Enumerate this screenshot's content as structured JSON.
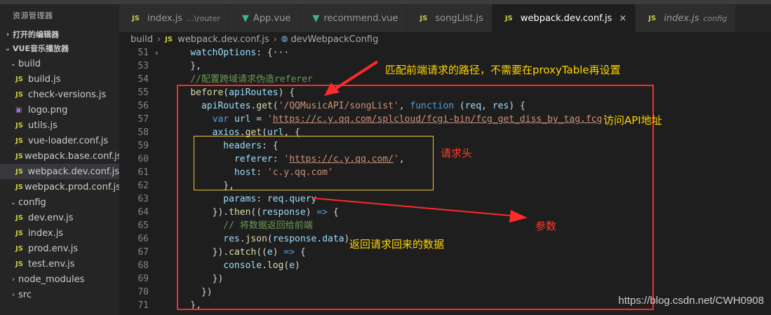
{
  "sidebar": {
    "title": "资源管理器",
    "open_editors": "打开的编辑器",
    "project": "VUE音乐播放器",
    "items": [
      {
        "label": "build",
        "kind": "folder"
      },
      {
        "label": "build.js",
        "kind": "js"
      },
      {
        "label": "check-versions.js",
        "kind": "js"
      },
      {
        "label": "logo.png",
        "kind": "png"
      },
      {
        "label": "utils.js",
        "kind": "js"
      },
      {
        "label": "vue-loader.conf.js",
        "kind": "js"
      },
      {
        "label": "webpack.base.conf.js",
        "kind": "js"
      },
      {
        "label": "webpack.dev.conf.js",
        "kind": "js",
        "selected": true
      },
      {
        "label": "webpack.prod.conf.js",
        "kind": "js"
      },
      {
        "label": "config",
        "kind": "folder"
      },
      {
        "label": "dev.env.js",
        "kind": "js"
      },
      {
        "label": "index.js",
        "kind": "js"
      },
      {
        "label": "prod.env.js",
        "kind": "js"
      },
      {
        "label": "test.env.js",
        "kind": "js"
      },
      {
        "label": "node_modules",
        "kind": "folder-closed"
      },
      {
        "label": "src",
        "kind": "folder-closed"
      }
    ]
  },
  "tabs": [
    {
      "label": "index.js",
      "sub": "...\\router",
      "icon": "js-icon"
    },
    {
      "label": "App.vue",
      "icon": "vue-icon"
    },
    {
      "label": "recommend.vue",
      "icon": "vue-icon"
    },
    {
      "label": "songList.js",
      "icon": "js-icon"
    },
    {
      "label": "webpack.dev.conf.js",
      "icon": "js-icon",
      "active": true,
      "close": "×"
    },
    {
      "label": "index.js",
      "sub": "config",
      "icon": "js-icon",
      "italic": true
    }
  ],
  "breadcrumb": {
    "folder": "build",
    "file": "webpack.dev.conf.js",
    "symbol": "devWebpackConfig"
  },
  "lines": [
    {
      "n": "51",
      "fold": "›",
      "code": [
        {
          "t": "    "
        },
        {
          "c": "prop",
          "t": "watchOptions"
        },
        {
          "t": ": {"
        },
        {
          "c": "pu",
          "t": "···"
        }
      ]
    },
    {
      "n": "53",
      "code": [
        {
          "t": "    },"
        }
      ]
    },
    {
      "n": "54",
      "code": [
        {
          "t": "    "
        },
        {
          "c": "cm",
          "t": "//配置跨域请求伪造referer"
        }
      ]
    },
    {
      "n": "55",
      "code": [
        {
          "t": "    "
        },
        {
          "c": "fn",
          "t": "before"
        },
        {
          "t": "("
        },
        {
          "c": "prop",
          "t": "apiRoutes"
        },
        {
          "t": ") {"
        }
      ]
    },
    {
      "n": "56",
      "code": [
        {
          "t": "      "
        },
        {
          "c": "prop",
          "t": "apiRoutes"
        },
        {
          "t": "."
        },
        {
          "c": "fn",
          "t": "get"
        },
        {
          "t": "("
        },
        {
          "c": "str",
          "t": "'/QQMusicAPI/songList'"
        },
        {
          "t": ", "
        },
        {
          "c": "kw",
          "t": "function"
        },
        {
          "t": " ("
        },
        {
          "c": "prop",
          "t": "req"
        },
        {
          "t": ", "
        },
        {
          "c": "prop",
          "t": "res"
        },
        {
          "t": ") {"
        }
      ]
    },
    {
      "n": "57",
      "code": [
        {
          "t": "        "
        },
        {
          "c": "kw",
          "t": "var"
        },
        {
          "t": " "
        },
        {
          "c": "prop",
          "t": "url"
        },
        {
          "t": " = "
        },
        {
          "c": "str",
          "t": "'"
        },
        {
          "c": "url",
          "t": "https://c.y.qq.com/splcloud/fcgi-bin/fcg_get_diss_by_tag.fcg"
        },
        {
          "c": "str",
          "t": "'"
        }
      ]
    },
    {
      "n": "58",
      "code": [
        {
          "t": "        "
        },
        {
          "c": "prop",
          "t": "axios"
        },
        {
          "t": "."
        },
        {
          "c": "fn",
          "t": "get"
        },
        {
          "t": "("
        },
        {
          "c": "prop",
          "t": "url"
        },
        {
          "t": ", {"
        }
      ]
    },
    {
      "n": "59",
      "code": [
        {
          "t": "          "
        },
        {
          "c": "prop",
          "t": "headers"
        },
        {
          "t": ": {"
        }
      ]
    },
    {
      "n": "60",
      "code": [
        {
          "t": "            "
        },
        {
          "c": "prop",
          "t": "referer"
        },
        {
          "t": ": "
        },
        {
          "c": "str",
          "t": "'"
        },
        {
          "c": "url",
          "t": "https://c.y.qq.com/"
        },
        {
          "c": "str",
          "t": "'"
        },
        {
          "t": ","
        }
      ]
    },
    {
      "n": "61",
      "code": [
        {
          "t": "            "
        },
        {
          "c": "prop",
          "t": "host"
        },
        {
          "t": ": "
        },
        {
          "c": "str",
          "t": "'c.y.qq.com'"
        }
      ]
    },
    {
      "n": "62",
      "code": [
        {
          "t": "          },"
        }
      ]
    },
    {
      "n": "63",
      "code": [
        {
          "t": "          "
        },
        {
          "c": "prop",
          "t": "params"
        },
        {
          "t": ": "
        },
        {
          "c": "prop",
          "t": "req"
        },
        {
          "t": "."
        },
        {
          "c": "prop",
          "t": "query"
        }
      ]
    },
    {
      "n": "64",
      "code": [
        {
          "t": "        })."
        },
        {
          "c": "fn",
          "t": "then"
        },
        {
          "t": "(("
        },
        {
          "c": "prop",
          "t": "response"
        },
        {
          "t": ") "
        },
        {
          "c": "kw",
          "t": "=>"
        },
        {
          "t": " {"
        }
      ]
    },
    {
      "n": "65",
      "code": [
        {
          "t": "          "
        },
        {
          "c": "cm",
          "t": "// 将数据返回给前端"
        }
      ]
    },
    {
      "n": "66",
      "code": [
        {
          "t": "          "
        },
        {
          "c": "prop",
          "t": "res"
        },
        {
          "t": "."
        },
        {
          "c": "fn",
          "t": "json"
        },
        {
          "t": "("
        },
        {
          "c": "prop",
          "t": "response"
        },
        {
          "t": "."
        },
        {
          "c": "prop",
          "t": "data"
        },
        {
          "t": ")"
        }
      ]
    },
    {
      "n": "67",
      "code": [
        {
          "t": "        })."
        },
        {
          "c": "fn",
          "t": "catch"
        },
        {
          "t": "(("
        },
        {
          "c": "prop",
          "t": "e"
        },
        {
          "t": ") "
        },
        {
          "c": "kw",
          "t": "=>"
        },
        {
          "t": " {"
        }
      ]
    },
    {
      "n": "68",
      "code": [
        {
          "t": "          "
        },
        {
          "c": "prop",
          "t": "console"
        },
        {
          "t": "."
        },
        {
          "c": "fn",
          "t": "log"
        },
        {
          "t": "("
        },
        {
          "c": "prop",
          "t": "e"
        },
        {
          "t": ")"
        }
      ]
    },
    {
      "n": "69",
      "code": [
        {
          "t": "        })"
        }
      ]
    },
    {
      "n": "70",
      "code": [
        {
          "t": "      })"
        }
      ]
    },
    {
      "n": "71",
      "code": [
        {
          "t": "    },"
        }
      ]
    }
  ],
  "annotations": {
    "route_note": "匹配前端请求的路径，不需要在proxyTable再设置",
    "api_note": "访问API地址",
    "headers_note": "请求头",
    "params_note": "参数",
    "response_note": "返回请求回来的数据"
  },
  "watermark": "https://blog.csdn.net/CWH0908",
  "colors": {
    "annotation_text": "#ffd400",
    "annotation_red": "#ff3b2f",
    "box_red": "#ff2a2a",
    "box_yellow": "#f2c230"
  }
}
